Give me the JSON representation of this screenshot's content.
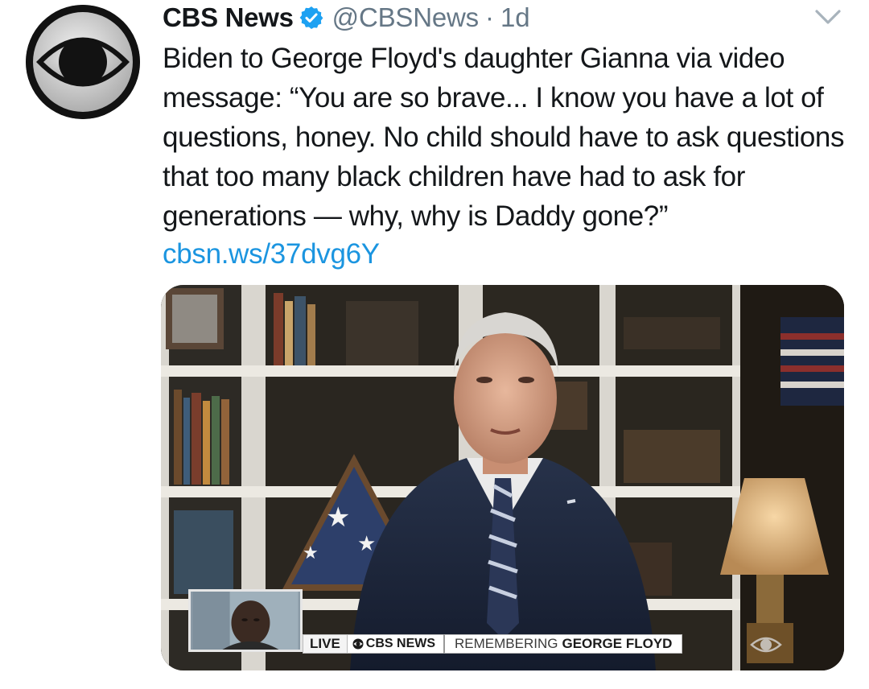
{
  "tweet": {
    "author_name": "CBS News",
    "handle": "@CBSNews",
    "separator": "·",
    "age": "1d",
    "text": "Biden to George Floyd's daughter Gianna via video message: “You are so brave... I know you have a lot of questions, honey. No child should have to ask questions that too many black children have had to ask for generations — why, why is Daddy gone?”",
    "link_text": "cbsn.ws/37dvg6Y",
    "icons": {
      "avatar": "cbs-eye-logo",
      "verified": "verified-badge-icon",
      "menu": "chevron-down-icon"
    }
  },
  "video": {
    "lower_third": {
      "live_label": "LIVE",
      "network_label": "CBS NEWS",
      "headline_prefix": "REMEMBERING",
      "headline_bold": "GEORGE FLOYD"
    }
  },
  "colors": {
    "link": "#1b95e0",
    "verified": "#1da1f2",
    "secondary_text": "#657786"
  }
}
